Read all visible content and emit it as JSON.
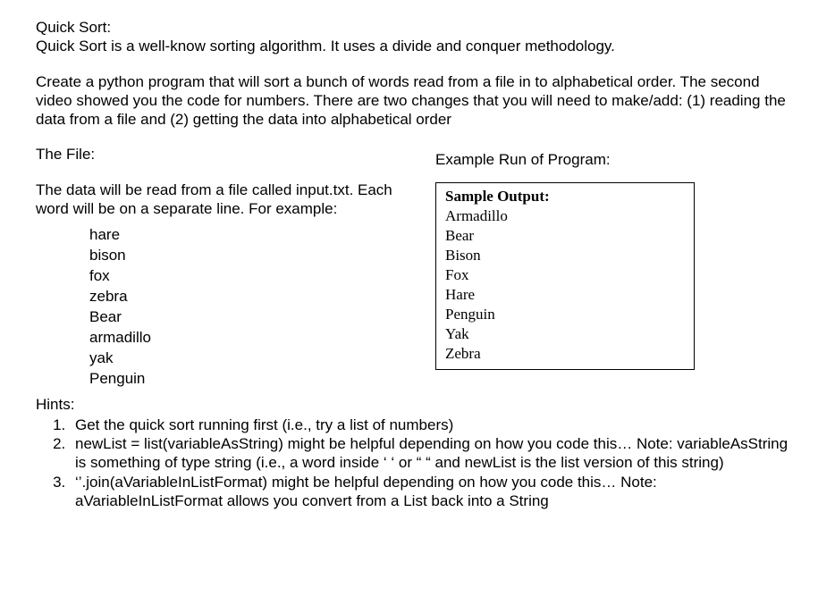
{
  "section_title": "Quick Sort:",
  "intro": "Quick Sort is a well-know sorting algorithm. It uses a divide and conquer methodology.",
  "task": "Create a python program that will sort a bunch of words read from a file in to alphabetical order. The second video showed you the code for numbers. There are two changes that you will need to make/add: (1) reading the data from a file and (2) getting the data into alphabetical order",
  "file_heading": "The File:",
  "file_desc": "The data will be read from a file called input.txt. Each word will be on a separate line. For example:",
  "file_items": [
    "hare",
    "bison",
    "fox",
    "zebra",
    "Bear",
    "armadillo",
    "yak",
    "Penguin"
  ],
  "example_heading": "Example Run of Program:",
  "sample_title": "Sample Output:",
  "sample_items": [
    "Armadillo",
    "Bear",
    "Bison",
    "Fox",
    "Hare",
    "Penguin",
    "Yak",
    "Zebra"
  ],
  "hints_heading": "Hints:",
  "hints": [
    "Get the quick sort running first (i.e., try a list of numbers)",
    "newList = list(variableAsString) might be helpful depending on how you code this… Note: variableAsString is something of type string (i.e., a word inside ‘ ‘ or “ “ and newList is the list version of this string)",
    "‘’.join(aVariableInListFormat) might be helpful depending on how you code this… Note: aVariableInListFormat allows you convert from a List back into a String"
  ]
}
